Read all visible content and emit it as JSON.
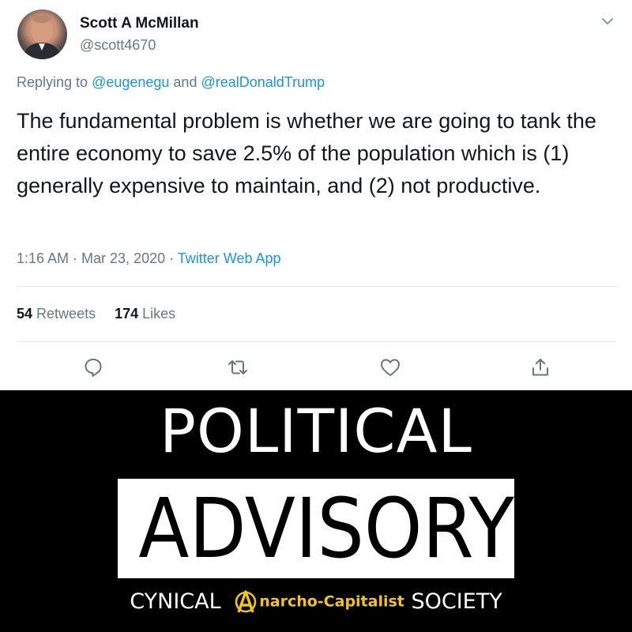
{
  "tweet": {
    "display_name": "Scott A McMillan",
    "handle": "@scott4670",
    "replying_prefix": "Replying to ",
    "reply_mention_1": "@eugenegu",
    "reply_and": " and ",
    "reply_mention_2": "@realDonaldTrump",
    "text": "The fundamental problem is whether we are going to tank the entire economy to save 2.5% of the population which is (1) generally expensive to maintain, and (2) not productive.",
    "time": "1:16 AM · Mar 23, 2020 · ",
    "source": "Twitter Web App",
    "retweets_count": "54",
    "retweets_label": "Retweets",
    "likes_count": "174",
    "likes_label": "Likes",
    "actions": [
      "reply-icon",
      "retweet-icon",
      "like-icon",
      "share-icon"
    ],
    "colors": {
      "link": "#1b95e0",
      "muted": "#657786",
      "text": "#14171a"
    }
  },
  "banner": {
    "line1": "POLITICAL",
    "line2": "ADVISORY",
    "footer_left": "CYNICAL ",
    "footer_brand_letter": "A",
    "footer_brand": "narcho-Capitalist",
    "footer_right": " SOCIETY",
    "colors": {
      "background": "#000000",
      "brand": "#f2c318"
    }
  }
}
